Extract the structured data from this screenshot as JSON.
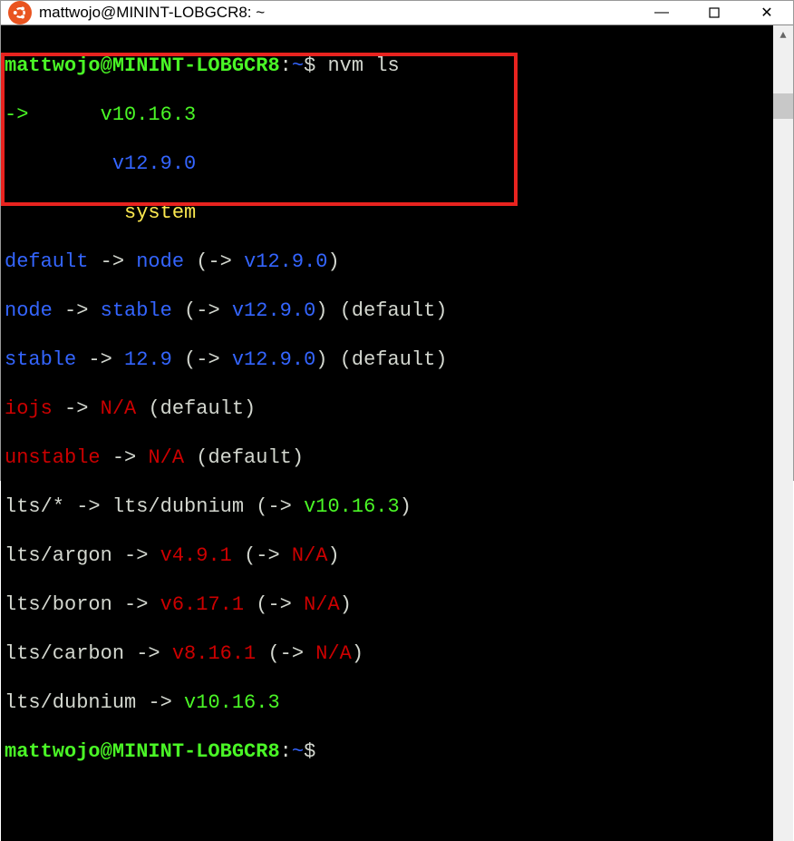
{
  "window": {
    "title": "mattwojo@MININT-LOBGCR8: ~",
    "minimize": "—",
    "maximize": "□",
    "close": "✕"
  },
  "prompt": {
    "user_host": "mattwojo@MININT-LOBGCR8",
    "sep": ":",
    "path": "~",
    "dollar": "$",
    "command": "nvm ls"
  },
  "lines": {
    "current_arrow": "->",
    "current_ver": "v10.16.3",
    "ver2": "v12.9.0",
    "system": "system",
    "default_label": "default",
    "arrow": "->",
    "node_word": "node",
    "open": "(->",
    "close": ")",
    "v1290": "v12.9.0",
    "default_paren": "(default)",
    "stable": "stable",
    "twelve9": "12.9",
    "iojs": "iojs",
    "na": "N/A",
    "unstable": "unstable",
    "lts_star": "lts/*",
    "lts_dubnium": "lts/dubnium",
    "v10163": "v10.16.3",
    "lts_argon": "lts/argon",
    "v491": "v4.9.1",
    "lts_boron": "lts/boron",
    "v6171": "v6.17.1",
    "lts_carbon": "lts/carbon",
    "v8161": "v8.16.1",
    "lts_dubnium2": "lts/dubnium",
    "v10163_2": "v10.16.3"
  }
}
